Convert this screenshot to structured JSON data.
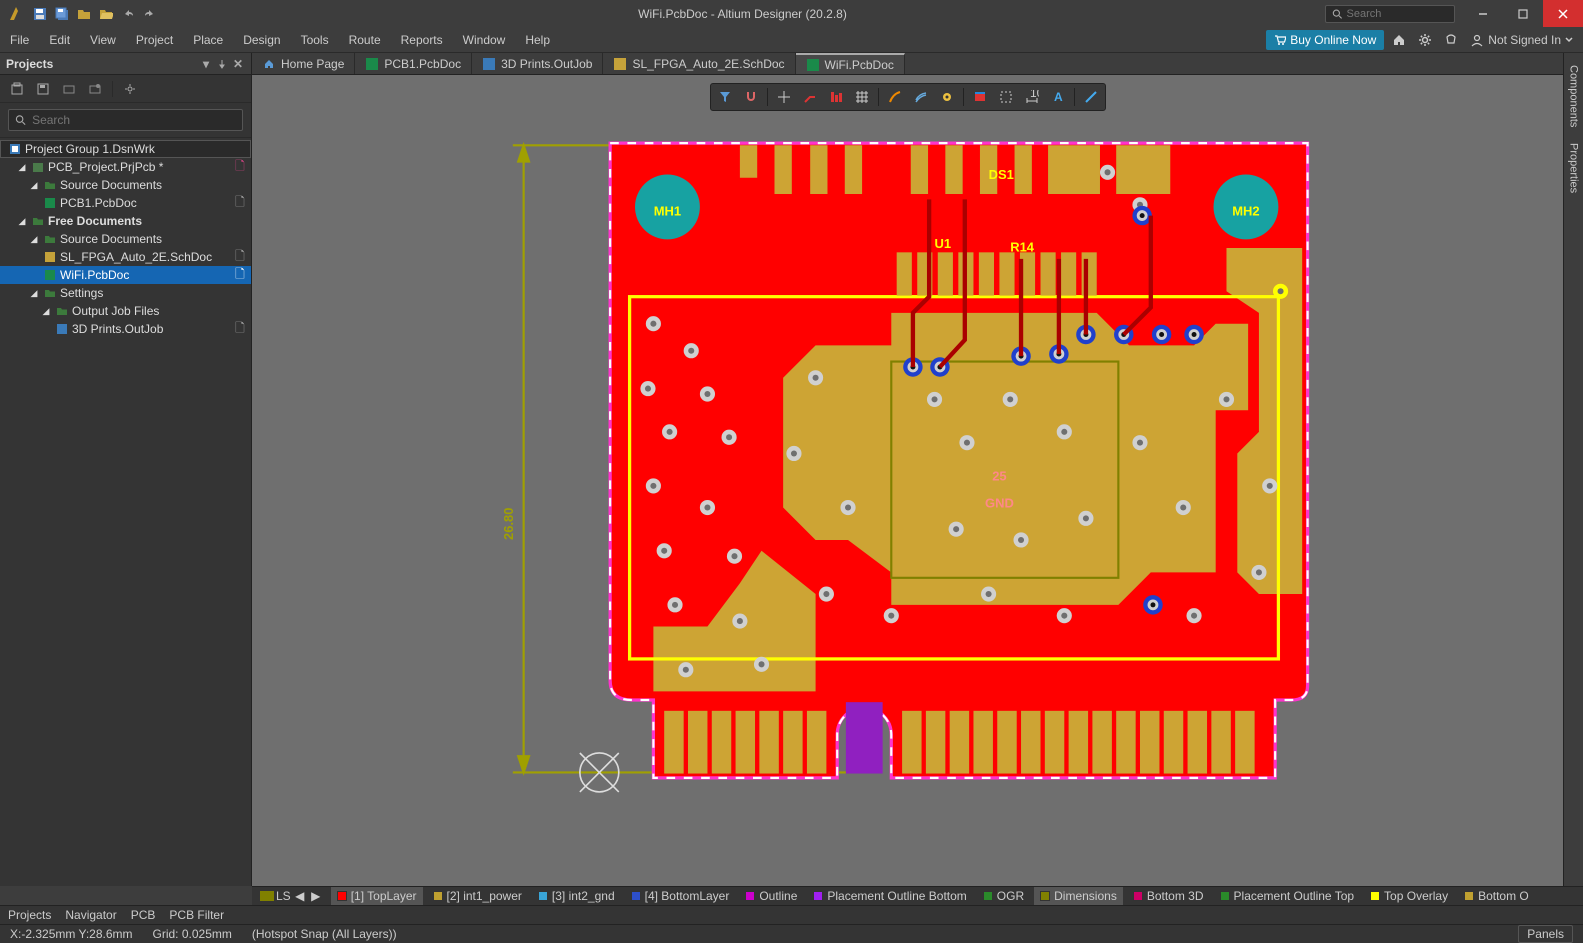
{
  "titlebar": {
    "title": "WiFi.PcbDoc - Altium Designer (20.2.8)",
    "search_placeholder": "Search"
  },
  "menu": {
    "items": [
      "File",
      "Edit",
      "View",
      "Project",
      "Place",
      "Design",
      "Tools",
      "Route",
      "Reports",
      "Window",
      "Help"
    ],
    "buy_online": "Buy Online Now",
    "not_signed_in": "Not Signed In"
  },
  "projects_panel": {
    "title": "Projects",
    "search_placeholder": "Search",
    "tree": {
      "group": "Project Group 1.DsnWrk",
      "project": "PCB_Project.PrjPcb *",
      "src_docs": "Source Documents",
      "pcb1": "PCB1.PcbDoc",
      "free_docs": "Free Documents",
      "src_docs2": "Source Documents",
      "schdoc": "SL_FPGA_Auto_2E.SchDoc",
      "wifi": "WiFi.PcbDoc",
      "settings": "Settings",
      "outjob_files": "Output Job Files",
      "outjob": "3D Prints.OutJob"
    }
  },
  "doc_tabs": {
    "home": "Home Page",
    "pcb1": "PCB1.PcbDoc",
    "outjob": "3D Prints.OutJob",
    "sch": "SL_FPGA_Auto_2E.SchDoc",
    "wifi": "WiFi.PcbDoc"
  },
  "right_tabs": {
    "components": "Components",
    "properties": "Properties"
  },
  "bottom_tabs": {
    "projects": "Projects",
    "navigator": "Navigator",
    "pcb": "PCB",
    "pcb_filter": "PCB Filter"
  },
  "layer_bar": {
    "ls": "LS",
    "layers": [
      {
        "name": "[1] TopLayer",
        "color": "#ff0000"
      },
      {
        "name": "[2] int1_power",
        "color": "#bfa030"
      },
      {
        "name": "[3] int2_gnd",
        "color": "#39a4d6"
      },
      {
        "name": "[4] BottomLayer",
        "color": "#2d4fc9"
      },
      {
        "name": "Outline",
        "color": "#cc00cc"
      },
      {
        "name": "Placement Outline Bottom",
        "color": "#a020f0"
      },
      {
        "name": "OGR",
        "color": "#2a8a2a"
      },
      {
        "name": "Dimensions",
        "color": "#808000"
      },
      {
        "name": "Bottom 3D",
        "color": "#cc0066"
      },
      {
        "name": "Placement Outline Top",
        "color": "#2a8a2a"
      },
      {
        "name": "Top Overlay",
        "color": "#ffff00"
      },
      {
        "name": "Bottom O",
        "color": "#bfa030"
      }
    ]
  },
  "statusbar": {
    "coords": "X:-2.325mm Y:28.6mm",
    "grid": "Grid: 0.025mm",
    "snap": "(Hotspot Snap (All Layers))",
    "panels": "Panels"
  },
  "pcb": {
    "dim_height": "26.80",
    "mh1": "MH1",
    "mh2": "MH2",
    "ds1": "DS1",
    "u1": "U1",
    "label25": "25",
    "gnd": "GND",
    "r14": "R14"
  }
}
